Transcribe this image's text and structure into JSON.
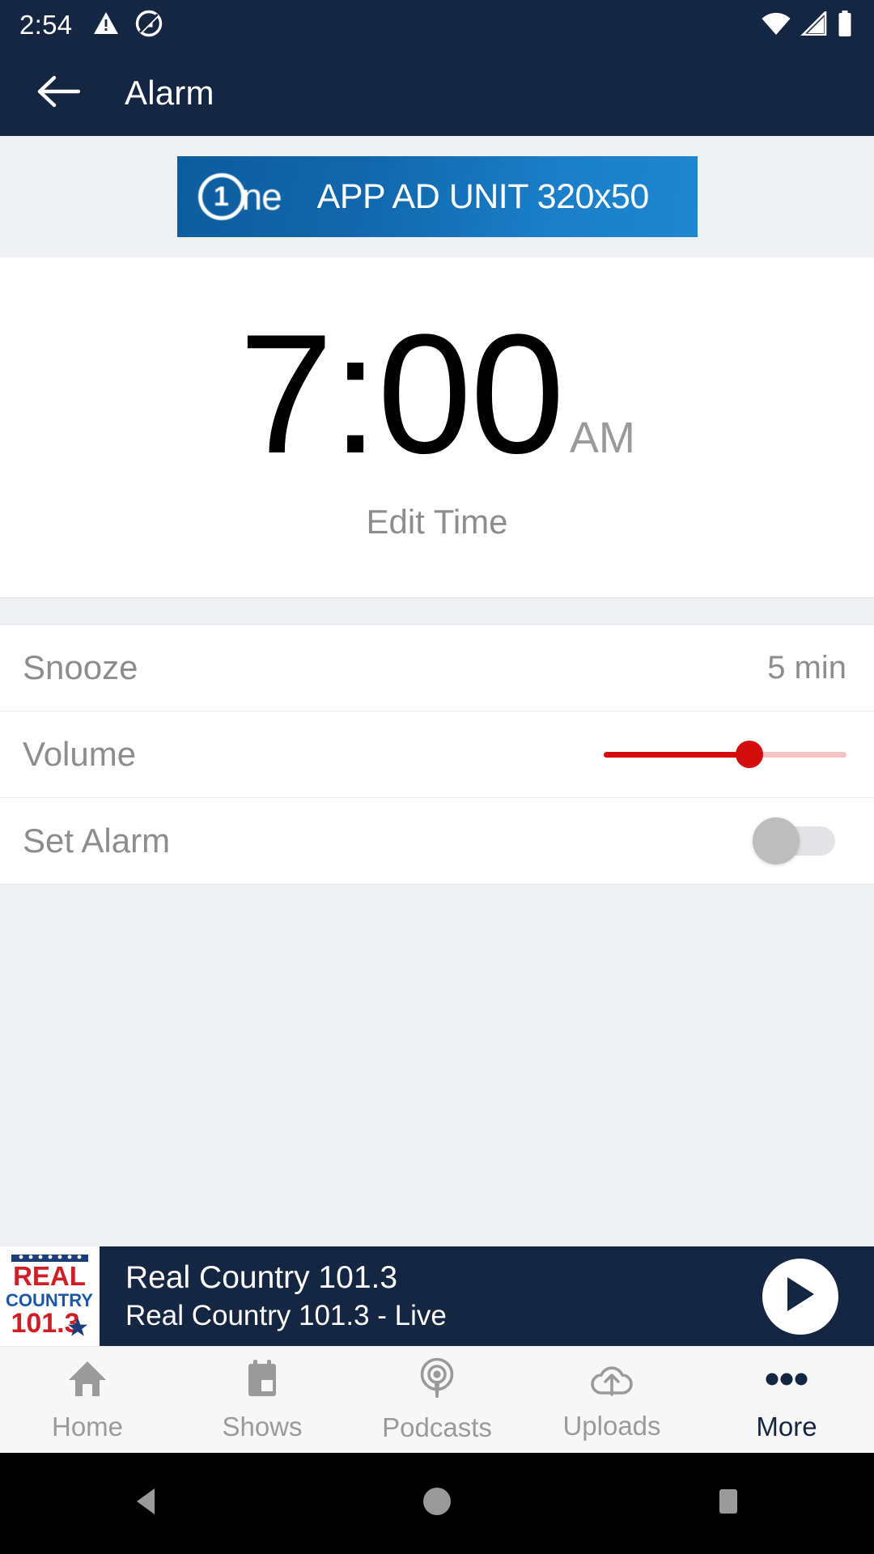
{
  "status_bar": {
    "time": "2:54",
    "icons": [
      "warning-triangle-icon",
      "do-not-disturb-icon",
      "wifi-icon",
      "cell-signal-icon",
      "battery-icon"
    ]
  },
  "app_bar": {
    "back_icon": "back-arrow-icon",
    "title": "Alarm"
  },
  "ad": {
    "logo_digit": "1",
    "logo_text": "ne",
    "text": "APP AD UNIT 320x50"
  },
  "alarm": {
    "time": "7:00",
    "meridiem": "AM",
    "edit_label": "Edit Time"
  },
  "settings": [
    {
      "label": "Snooze",
      "value": "5 min",
      "type": "value"
    },
    {
      "label": "Volume",
      "value": "",
      "type": "slider",
      "percent": 60
    },
    {
      "label": "Set Alarm",
      "value": "",
      "type": "toggle",
      "on": false
    }
  ],
  "player": {
    "art_line1": "REAL",
    "art_line2": "COUNTRY",
    "art_line3": "101.3",
    "title": "Real Country 101.3",
    "subtitle": "Real Country 101.3  - Live",
    "play_icon": "play-icon"
  },
  "bottom_nav": [
    {
      "label": "Home",
      "icon": "home-icon",
      "active": false
    },
    {
      "label": "Shows",
      "icon": "calendar-icon",
      "active": false
    },
    {
      "label": "Podcasts",
      "icon": "podcast-icon",
      "active": false
    },
    {
      "label": "Uploads",
      "icon": "cloud-upload-icon",
      "active": false
    },
    {
      "label": "More",
      "icon": "more-dots-icon",
      "active": true
    }
  ],
  "android_nav": {
    "back": "android-back-icon",
    "home": "android-home-icon",
    "recents": "android-recents-icon"
  },
  "colors": {
    "navy": "#152642",
    "accent_red": "#d50c0c",
    "page_bg": "#eff0f4",
    "muted_text": "#8d8d8d"
  }
}
